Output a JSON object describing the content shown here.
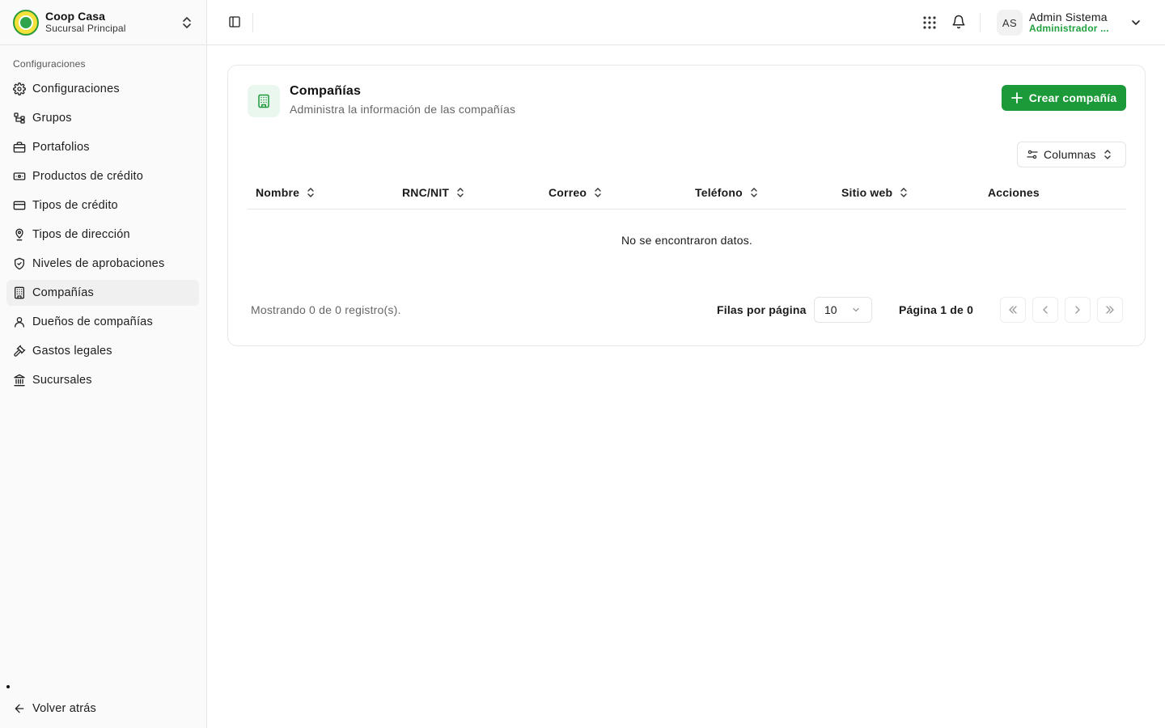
{
  "brand": {
    "name": "Coop Casa",
    "branch": "Sucursal Principal"
  },
  "sidebar": {
    "section_label": "Configuraciones",
    "items": [
      {
        "label": "Configuraciones",
        "icon": "gear-icon"
      },
      {
        "label": "Grupos",
        "icon": "group-tree-icon"
      },
      {
        "label": "Portafolios",
        "icon": "briefcase-icon"
      },
      {
        "label": "Productos de crédito",
        "icon": "banknote-icon"
      },
      {
        "label": "Tipos de crédito",
        "icon": "credit-card-icon"
      },
      {
        "label": "Tipos de dirección",
        "icon": "map-pin-icon"
      },
      {
        "label": "Niveles de aprobaciones",
        "icon": "shield-check-icon"
      },
      {
        "label": "Compañías",
        "icon": "building-icon",
        "active": true
      },
      {
        "label": "Dueños de compañías",
        "icon": "user-icon"
      },
      {
        "label": "Gastos legales",
        "icon": "gavel-icon"
      },
      {
        "label": "Sucursales",
        "icon": "bank-icon"
      }
    ],
    "back_label": "Volver atrás"
  },
  "topbar": {
    "user": {
      "initials": "AS",
      "name": "Admin Sistema",
      "role": "Administrador ..."
    }
  },
  "page": {
    "title": "Compañías",
    "subtitle": "Administra la información de las compañías",
    "create_button": "Crear compañía",
    "columns_button": "Columnas",
    "table": {
      "headers": [
        "Nombre",
        "RNC/NIT",
        "Correo",
        "Teléfono",
        "Sitio web",
        "Acciones"
      ],
      "empty_text": "No se encontraron datos."
    },
    "footer": {
      "showing": "Mostrando 0 de 0 registro(s).",
      "rows_label": "Filas por página",
      "rows_value": "10",
      "page_label": "Página 1 de 0"
    }
  },
  "colors": {
    "accent": "#1c9a3a",
    "role_text": "#21a140",
    "sidebar_bg": "#fafafa"
  }
}
